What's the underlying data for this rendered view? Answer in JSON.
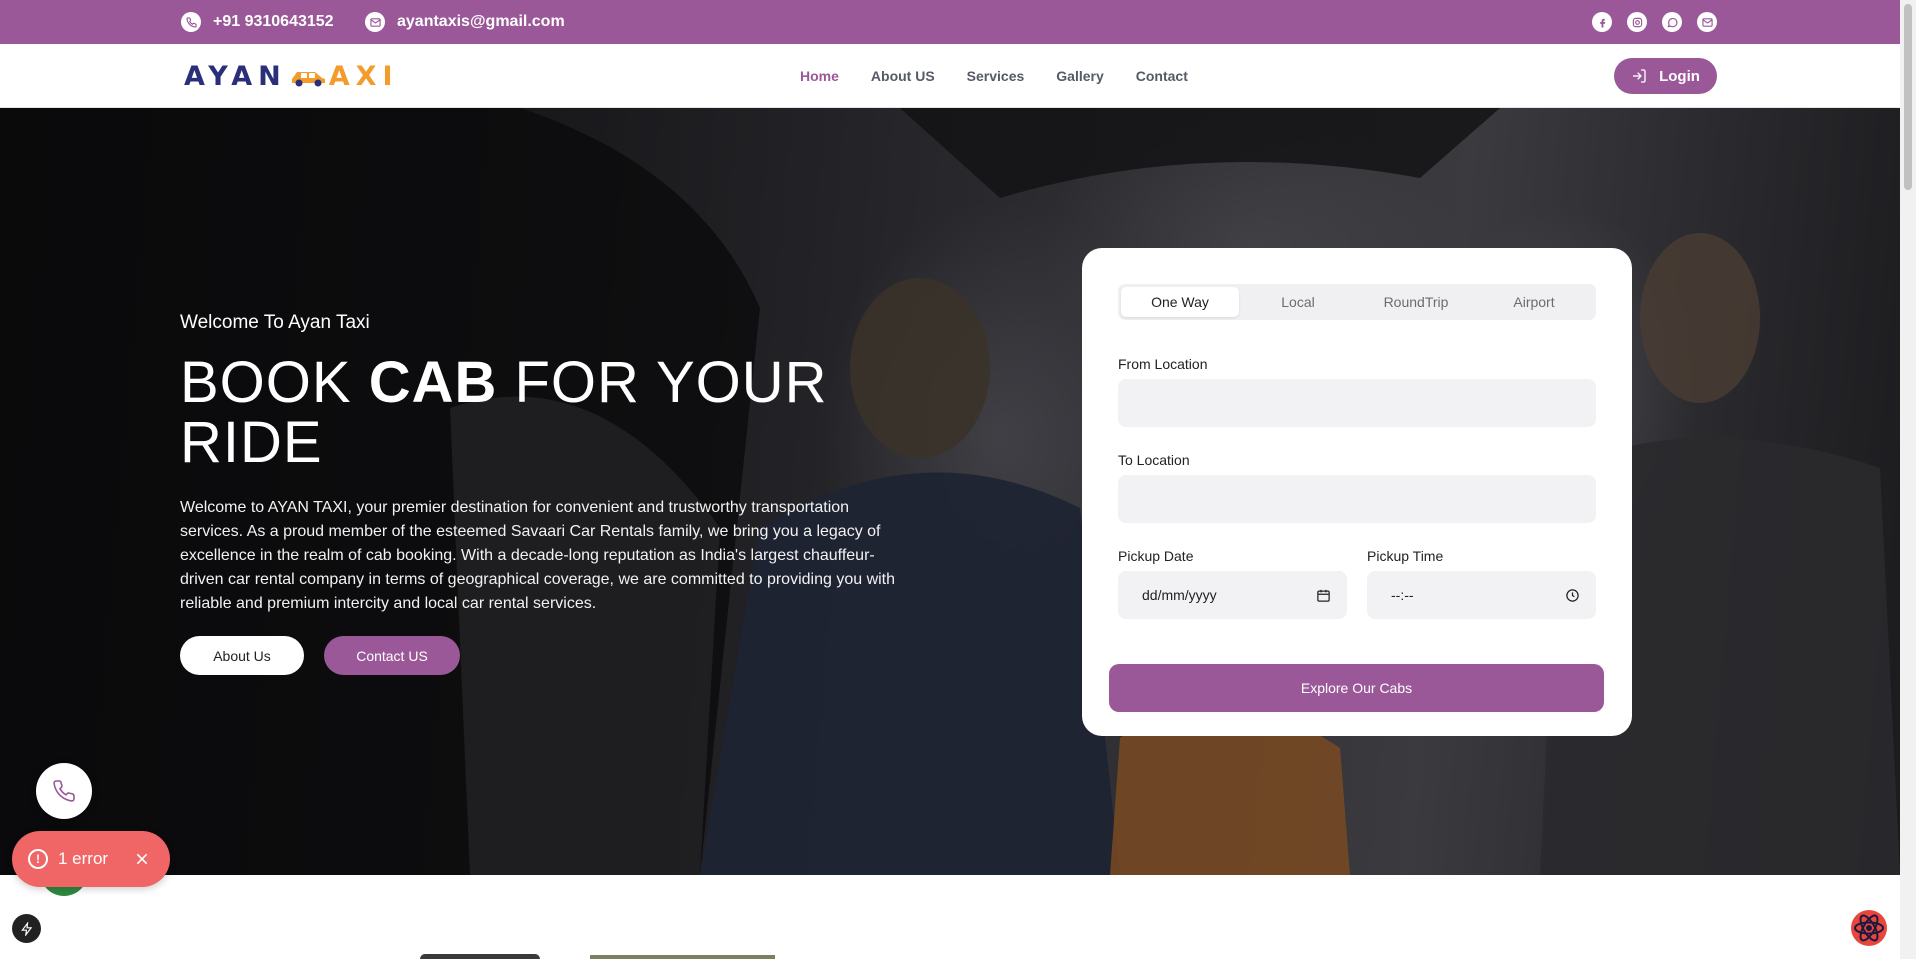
{
  "topbar": {
    "phone": "+91 9310643152",
    "email": "ayantaxis@gmail.com",
    "socials": [
      "facebook-icon",
      "instagram-icon",
      "whatsapp-icon",
      "mail-icon"
    ]
  },
  "nav": {
    "logo_left": "AYAN",
    "logo_right": "AXI",
    "links": [
      "Home",
      "About US",
      "Services",
      "Gallery",
      "Contact"
    ],
    "active": "Home",
    "login_label": "Login"
  },
  "hero": {
    "welcome": "Welcome To Ayan Taxi",
    "title_pre": "BOOK ",
    "title_bold": "CAB",
    "title_post": " FOR YOUR RIDE",
    "description": "Welcome to AYAN TAXI, your premier destination for convenient and trustworthy transportation services. As a proud member of the esteemed Savaari Car Rentals family, we bring you a legacy of excellence in the realm of cab booking. With a decade-long reputation as India's largest chauffeur-driven car rental company in terms of geographical coverage, we are committed to providing you with reliable and premium intercity and local car rental services.",
    "btn_about": "About Us",
    "btn_contact": "Contact US"
  },
  "booking": {
    "tabs": [
      "One Way",
      "Local",
      "RoundTrip",
      "Airport"
    ],
    "active_tab": "One Way",
    "from_label": "From Location",
    "from_value": "",
    "to_label": "To Location",
    "to_value": "",
    "date_label": "Pickup Date",
    "date_placeholder": "dd/mm/yyyy",
    "time_label": "Pickup Time",
    "time_placeholder": "--:--",
    "submit": "Explore Our Cabs"
  },
  "overlay": {
    "error_text": "1 error"
  },
  "colors": {
    "brand": "#9b5899",
    "error": "#f06565",
    "logo_blue": "#2b2f7a",
    "logo_orange": "#f39c2b"
  }
}
